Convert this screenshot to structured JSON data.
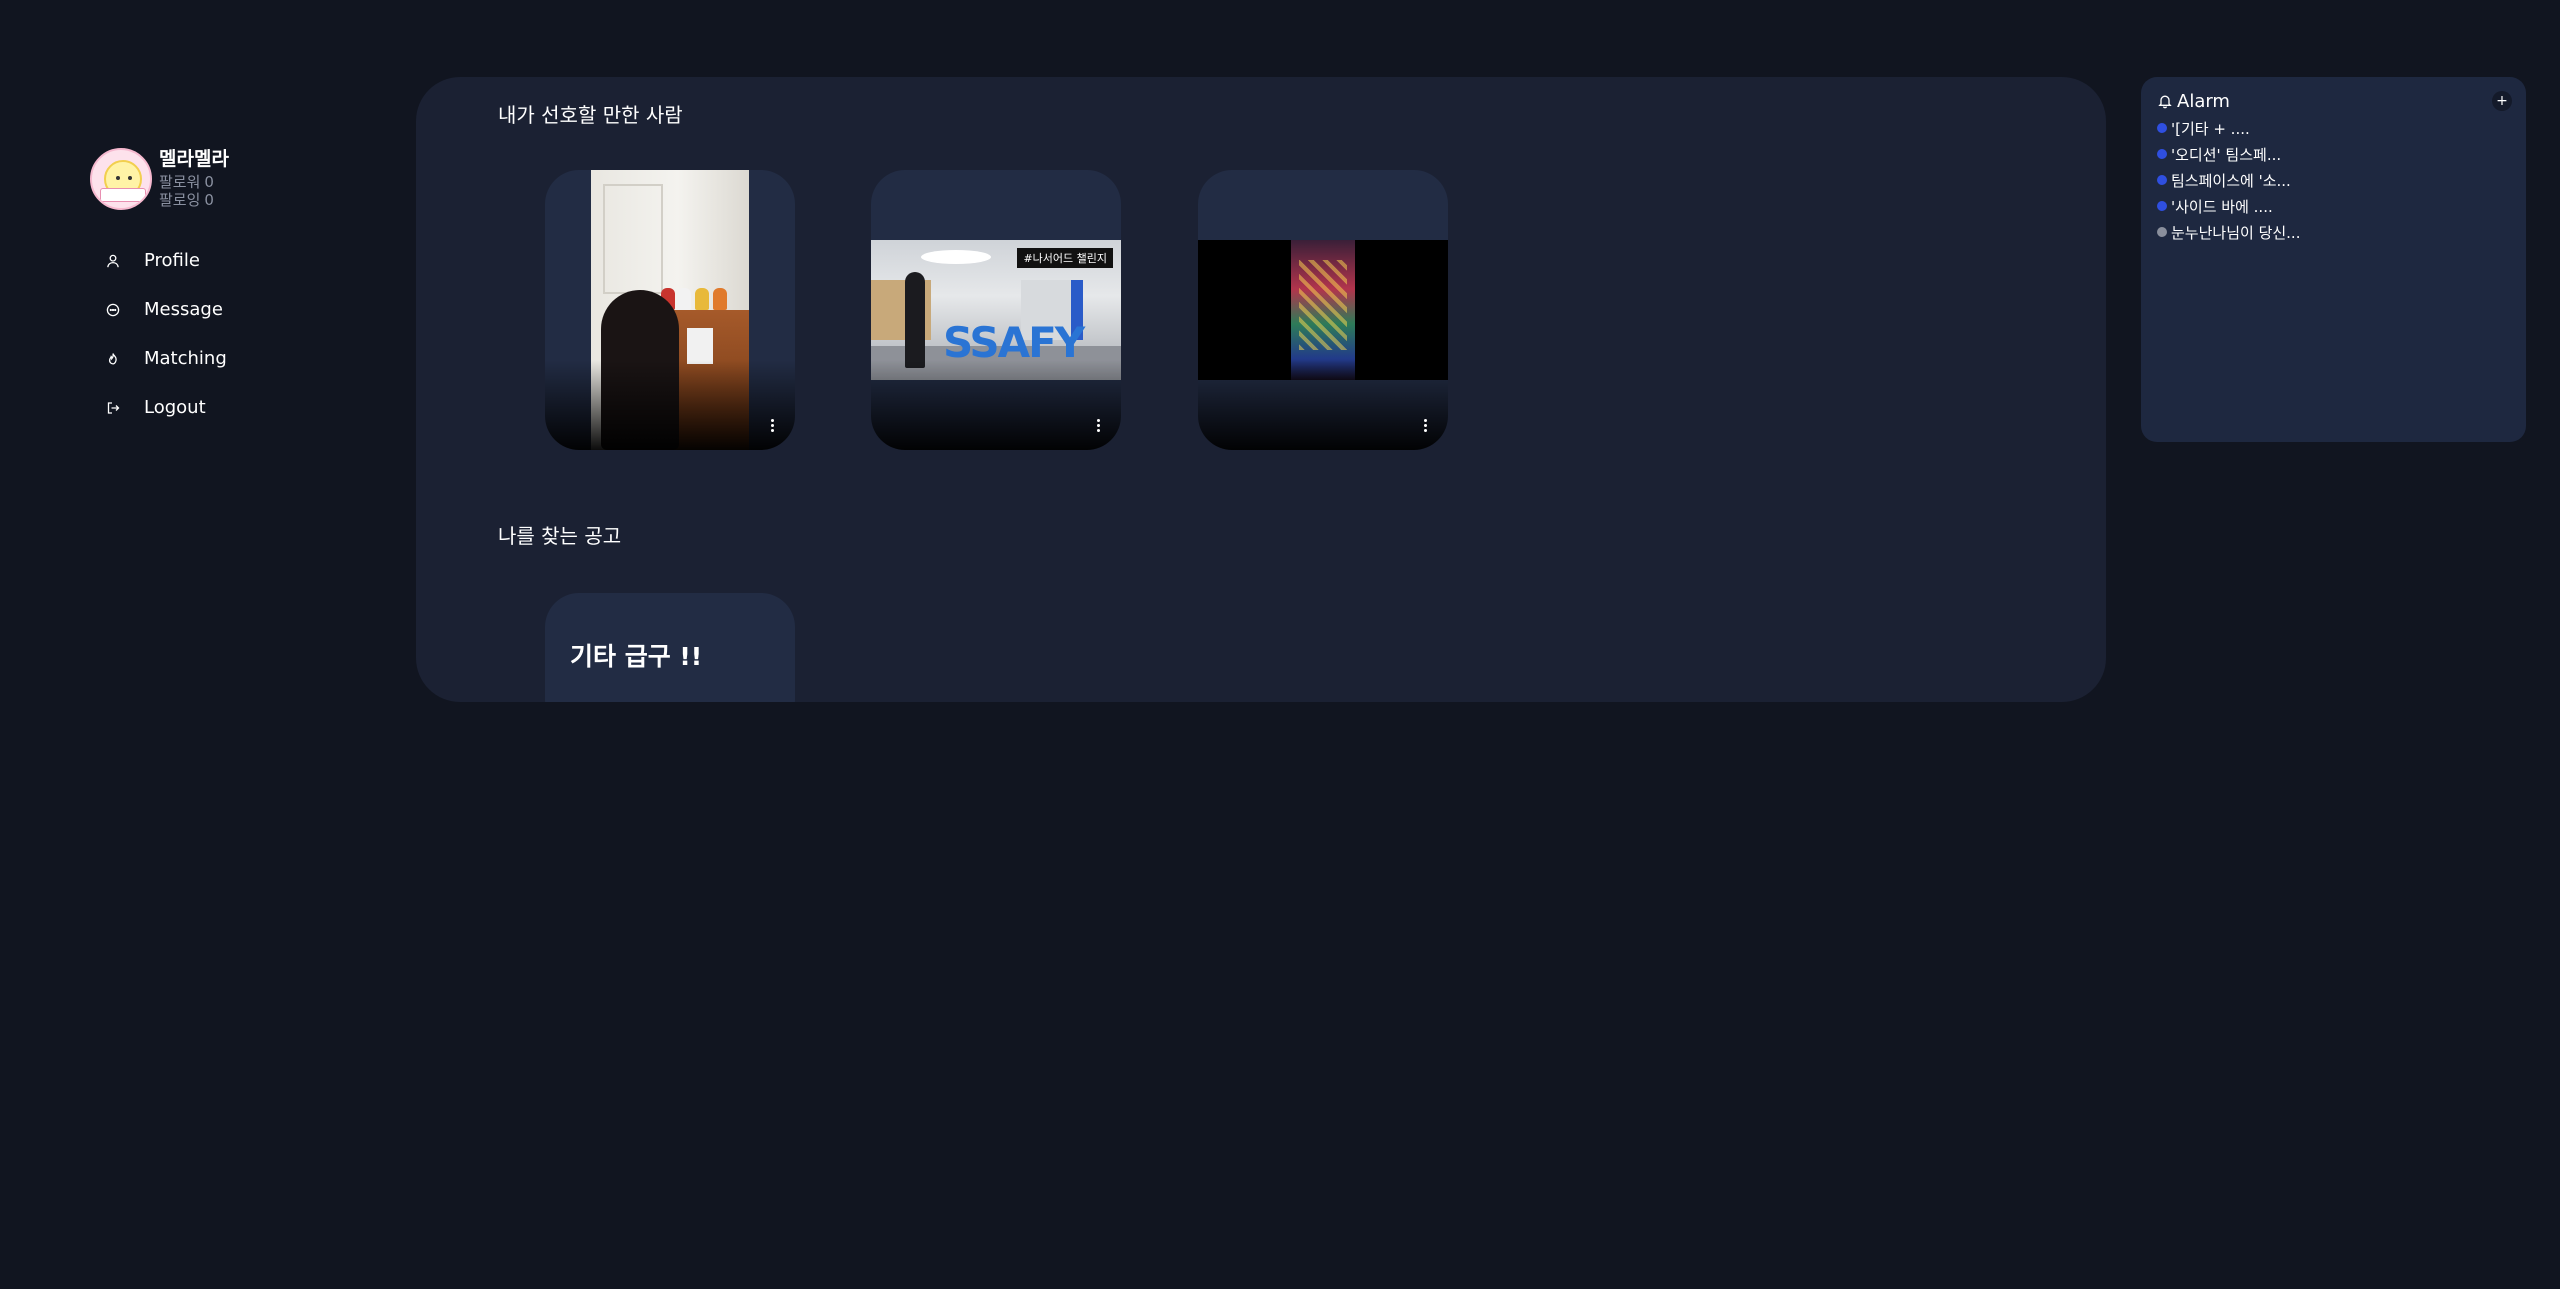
{
  "sidebar": {
    "username": "멜라멜라",
    "followers_label": "팔로워",
    "followers_count": "0",
    "following_label": "팔로잉",
    "following_count": "0",
    "nav": [
      {
        "label": "Profile",
        "icon": "user-icon"
      },
      {
        "label": "Message",
        "icon": "message-icon"
      },
      {
        "label": "Matching",
        "icon": "flame-icon"
      },
      {
        "label": "Logout",
        "icon": "logout-icon"
      }
    ]
  },
  "main": {
    "recommended_title": "내가 선호할 만한 사람",
    "recommended_cards": [
      {
        "media": "piano-video-thumbnail"
      },
      {
        "media": "ssafy-video-thumbnail",
        "caption": "#나서어드 챌린지",
        "sign_text": "SSAFY"
      },
      {
        "media": "neon-video-thumbnail"
      }
    ],
    "jobs_title": "나를 찾는 공고",
    "job_cards": [
      {
        "title": "기타 급구 !!"
      }
    ]
  },
  "alarm": {
    "title": "Alarm",
    "add_label": "+",
    "items": [
      {
        "text": "'[기타 + ....",
        "unread": true
      },
      {
        "text": "'오디션' 팀스페...",
        "unread": true
      },
      {
        "text": "팀스페이스에 '소...",
        "unread": true
      },
      {
        "text": "'사이드 바에 ....",
        "unread": true
      },
      {
        "text": "눈누난나님이 당신...",
        "unread": false
      }
    ]
  },
  "colors": {
    "background": "#111520",
    "panel": "#1b2133",
    "card": "#222c44",
    "alarm_panel": "#1e2840",
    "unread_dot": "#2f4fe0",
    "read_dot": "#8a8f9c"
  }
}
